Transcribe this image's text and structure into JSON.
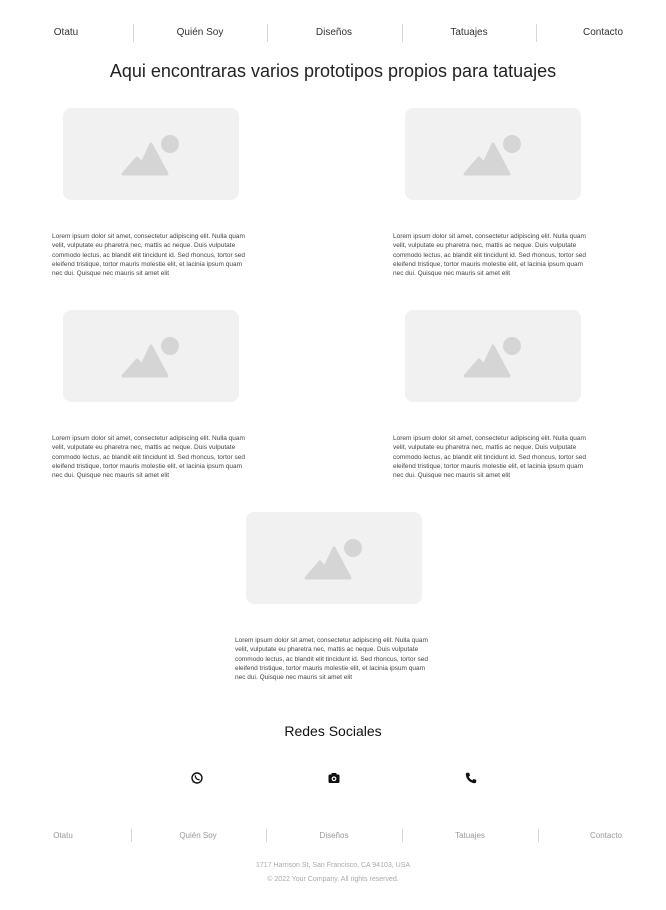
{
  "nav": [
    "Otatu",
    "Quién Soy",
    "Diseños",
    "Tatuajes",
    "Contacto"
  ],
  "title": "Aqui encontraras varios prototipos propios para tatuajes",
  "cards": [
    {
      "image": "image-placeholder-icon",
      "text": "Lorem ipsum dolor sit amet, consectetur adipiscing elit. Nulla quam velit, vulputate eu pharetra nec, mattis ac neque. Duis vulputate commodo lectus, ac blandit elit tincidunt id. Sed rhoncus, tortor sed eleifend tristique, tortor mauris molestie elit, et lacinia ipsum quam nec dui. Quisque nec mauris sit amet elit"
    },
    {
      "image": "image-placeholder-icon",
      "text": "Lorem ipsum dolor sit amet, consectetur adipiscing elit. Nulla quam velit, vulputate eu pharetra nec, mattis ac neque. Duis vulputate commodo lectus, ac blandit elit tincidunt id. Sed rhoncus, tortor sed eleifend tristique, tortor mauris molestie elit, et lacinia ipsum quam nec dui. Quisque nec mauris sit amet elit"
    },
    {
      "image": "image-placeholder-icon",
      "text": "Lorem ipsum dolor sit amet, consectetur adipiscing elit. Nulla quam velit, vulputate eu pharetra nec, mattis ac neque. Duis vulputate commodo lectus, ac blandit elit tincidunt id. Sed rhoncus, tortor sed eleifend tristique, tortor mauris molestie elit, et lacinia ipsum quam nec dui. Quisque nec mauris sit amet elit"
    },
    {
      "image": "image-placeholder-icon",
      "text": "Lorem ipsum dolor sit amet, consectetur adipiscing elit. Nulla quam velit, vulputate eu pharetra nec, mattis ac neque. Duis vulputate commodo lectus, ac blandit elit tincidunt id. Sed rhoncus, tortor sed eleifend tristique, tortor mauris molestie elit, et lacinia ipsum quam nec dui. Quisque nec mauris sit amet elit"
    },
    {
      "image": "image-placeholder-icon",
      "text": "Lorem ipsum dolor sit amet, consectetur adipiscing elit. Nulla quam velit, vulputate eu pharetra nec, mattis ac neque. Duis vulputate commodo lectus, ac blandit elit tincidunt id. Sed rhoncus, tortor sed eleifend tristique, tortor mauris molestie elit, et lacinia ipsum quam nec dui. Quisque nec mauris sit amet elit"
    }
  ],
  "social": {
    "heading": "Redes Sociales",
    "icons": [
      "whatsapp-icon",
      "camera-icon",
      "phone-icon"
    ]
  },
  "footer": {
    "nav": [
      "Otatu",
      "Quién Soy",
      "Diseños",
      "Tatuajes",
      "Contacto"
    ],
    "address": "1717 Harrison St, San Francisco, CA 94103, USA",
    "copyright": "© 2022 Your Company.  All rights reserved."
  },
  "colors": {
    "placeholder_bg": "#f2f1f1",
    "placeholder_icon": "#d6d5d5",
    "text": "#222222",
    "muted": "#999999"
  }
}
